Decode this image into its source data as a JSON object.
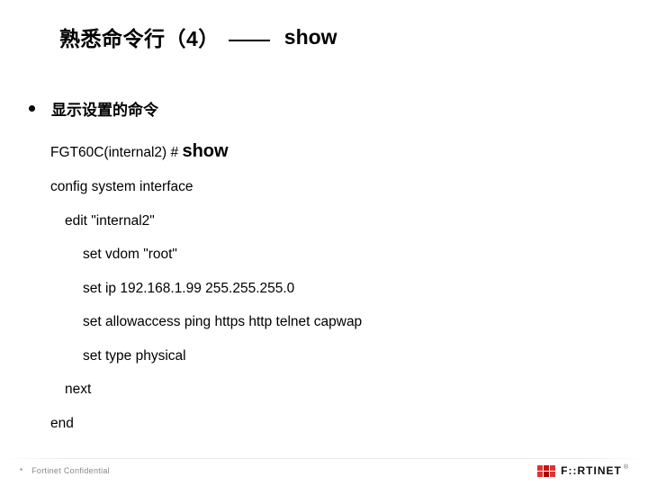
{
  "title": {
    "prefix": "熟悉命令行（4）",
    "command": "show"
  },
  "bullet": "显示设置的命令",
  "cli": {
    "prompt": "FGT60C(internal2) #",
    "prompt_cmd": "show",
    "lines": [
      "config system interface",
      "edit \"internal2\"",
      "set vdom \"root\"",
      "set ip 192.168.1.99 255.255.255.0",
      "set allowaccess ping https http telnet capwap",
      "set type physical",
      "next",
      "end"
    ]
  },
  "footer": {
    "page": "*",
    "confidential": "Fortinet Confidential",
    "logo_text": "F::RTINET",
    "logo_r": "®"
  }
}
